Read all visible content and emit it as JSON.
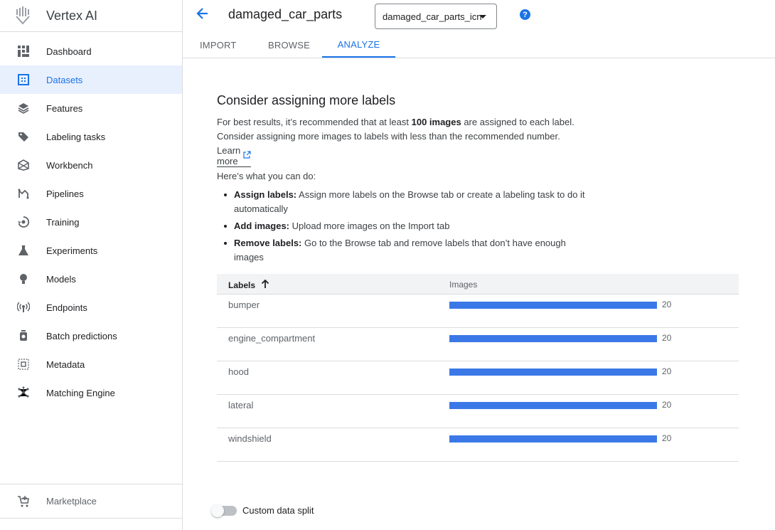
{
  "app": {
    "name": "Vertex AI"
  },
  "sidebar": {
    "items": [
      {
        "label": "Dashboard",
        "icon": "dashboard-icon"
      },
      {
        "label": "Datasets",
        "icon": "datasets-icon",
        "active": true
      },
      {
        "label": "Features",
        "icon": "features-icon"
      },
      {
        "label": "Labeling tasks",
        "icon": "tag-icon"
      },
      {
        "label": "Workbench",
        "icon": "workbench-icon"
      },
      {
        "label": "Pipelines",
        "icon": "pipelines-icon"
      },
      {
        "label": "Training",
        "icon": "training-icon"
      },
      {
        "label": "Experiments",
        "icon": "flask-icon"
      },
      {
        "label": "Models",
        "icon": "bulb-icon"
      },
      {
        "label": "Endpoints",
        "icon": "endpoints-icon"
      },
      {
        "label": "Batch predictions",
        "icon": "batch-icon"
      },
      {
        "label": "Metadata",
        "icon": "metadata-icon"
      },
      {
        "label": "Matching Engine",
        "icon": "matching-engine-icon"
      }
    ],
    "footer": {
      "label": "Marketplace",
      "icon": "cart-icon"
    }
  },
  "header": {
    "dataset_title": "damaged_car_parts",
    "dataset_select_value": "damaged_car_parts_icn",
    "help": "?"
  },
  "tabs": [
    {
      "label": "IMPORT"
    },
    {
      "label": "BROWSE"
    },
    {
      "label": "ANALYZE",
      "active": true
    }
  ],
  "main": {
    "heading": "Consider assigning more labels",
    "intro_line1_a": "For best results, it’s recommended that at least ",
    "intro_line1_bold": "100 images",
    "intro_line1_b": " are assigned to each label.",
    "intro_line2": "Consider assigning more images to labels with less than the recommended number.",
    "learn_more": "Learn more",
    "todo_heading": "Here’s what you can do:",
    "bullets": [
      {
        "title": "Assign labels:",
        "text": " Assign more labels on the Browse tab or create a labeling task to do it automatically"
      },
      {
        "title": "Add images:",
        "text": " Upload more images on the Import tab"
      },
      {
        "title": "Remove labels:",
        "text": " Go to the Browse tab and remove labels that don’t have enough images"
      }
    ]
  },
  "table": {
    "col_labels": "Labels",
    "col_images": "Images",
    "rows": [
      {
        "label": "bumper",
        "value": 20,
        "fill": 1.0
      },
      {
        "label": "engine_compartment",
        "value": 20,
        "fill": 1.0
      },
      {
        "label": "hood",
        "value": 20,
        "fill": 1.0
      },
      {
        "label": "lateral",
        "value": 20,
        "fill": 1.0
      },
      {
        "label": "windshield",
        "value": 20,
        "fill": 1.0
      }
    ]
  },
  "custom_split": {
    "label": "Custom data split",
    "enabled": false
  },
  "colors": {
    "accent": "#1a73e8",
    "bar": "#3b78e7",
    "active_bg": "#e8f0fe"
  }
}
